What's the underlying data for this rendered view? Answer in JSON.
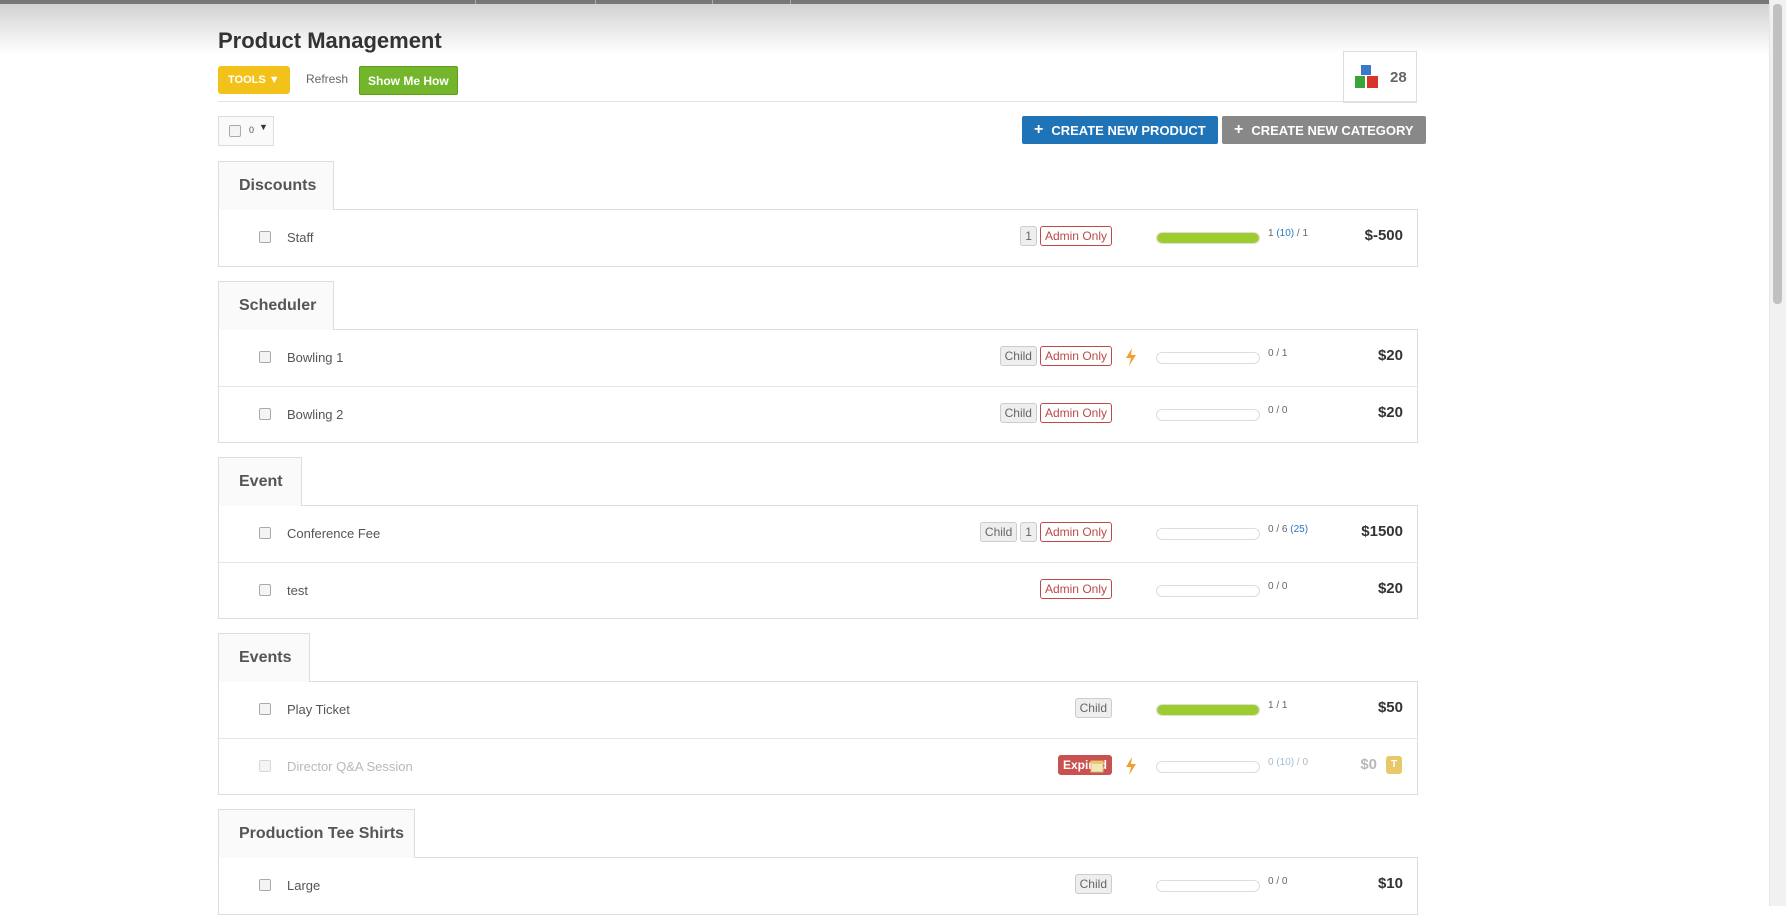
{
  "header": {
    "title": "Product Management",
    "tools_label": "TOOLS",
    "refresh_label": "Refresh",
    "show_me_label": "Show Me How",
    "product_count": "28"
  },
  "toolbar": {
    "selected_count": "0",
    "create_product_label": "CREATE NEW PRODUCT",
    "create_category_label": "CREATE NEW CATEGORY"
  },
  "colors": {
    "tools": "#f2c21b",
    "show_me": "#74b62b",
    "create_product": "#1f73b7",
    "create_category": "#888888",
    "admin_only": "#b94a48",
    "expired": "#c9514f",
    "progress_fill": "#9ccc2e"
  },
  "categories": [
    {
      "name": "Discounts",
      "products": [
        {
          "name": "Staff",
          "badges": [
            "1",
            "Admin Only"
          ],
          "progress": 1.0,
          "sold": "1",
          "cap": "(10)",
          "total": "1",
          "price": "$-500"
        }
      ]
    },
    {
      "name": "Scheduler",
      "products": [
        {
          "name": "Bowling 1",
          "badges": [
            "Child",
            "Admin Only"
          ],
          "icons": [
            "lightning-icon"
          ],
          "progress": 0,
          "sold": "0",
          "total": "1",
          "price": "$20"
        },
        {
          "name": "Bowling 2",
          "badges": [
            "Child",
            "Admin Only"
          ],
          "progress": 0,
          "sold": "0",
          "total": "0",
          "price": "$20"
        }
      ]
    },
    {
      "name": "Event",
      "products": [
        {
          "name": "Conference Fee",
          "badges": [
            "Child",
            "1",
            "Admin Only"
          ],
          "progress": 0,
          "sold": "0",
          "total": "6",
          "cap": "(25)",
          "price": "$1500"
        },
        {
          "name": "test",
          "badges": [
            "Admin Only"
          ],
          "progress": 0,
          "sold": "0",
          "total": "0",
          "price": "$20"
        }
      ]
    },
    {
      "name": "Events",
      "products": [
        {
          "name": "Play Ticket",
          "badges": [
            "Child"
          ],
          "progress": 1.0,
          "sold": "1",
          "total": "1",
          "price": "$50"
        },
        {
          "name": "Director Q&A Session",
          "badges": [
            "Expired"
          ],
          "icons": [
            "calendar-icon",
            "lightning-icon"
          ],
          "progress": 0,
          "sold": "0",
          "cap": "(10)",
          "total": "0",
          "price": "$0",
          "tag": "T",
          "muted": true
        }
      ]
    },
    {
      "name": "Production Tee Shirts",
      "products": [
        {
          "name": "Large",
          "badges": [
            "Child"
          ],
          "progress": 0,
          "sold": "0",
          "total": "0",
          "price": "$10"
        }
      ]
    }
  ]
}
